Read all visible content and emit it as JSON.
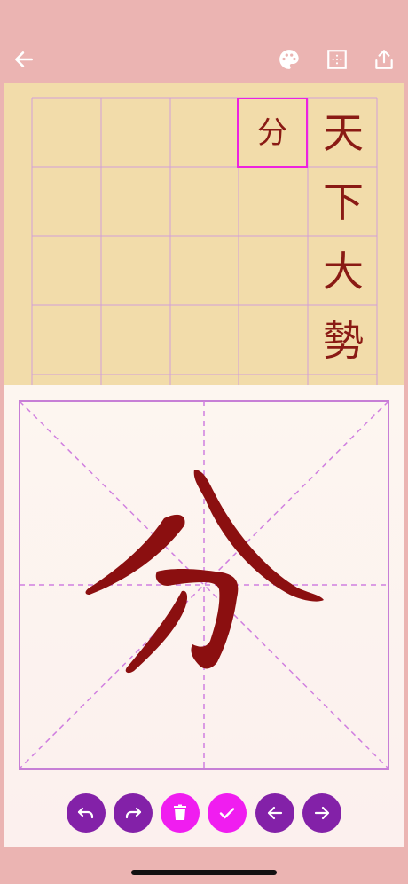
{
  "header": {
    "back_icon": "arrow-left-icon",
    "palette_icon": "palette-icon",
    "grid_icon": "grid-focus-icon",
    "share_icon": "share-icon"
  },
  "reference_column": {
    "characters": [
      "天",
      "下",
      "大",
      "勢"
    ]
  },
  "written_cells": [
    {
      "char": "分",
      "selected": true
    }
  ],
  "practice_pad": {
    "character": "分"
  },
  "toolbar": {
    "buttons": [
      {
        "icon": "undo-icon",
        "color": "#8321a8"
      },
      {
        "icon": "redo-icon",
        "color": "#8321a8"
      },
      {
        "icon": "trash-icon",
        "color": "#f01df0"
      },
      {
        "icon": "check-icon",
        "color": "#f01df0"
      },
      {
        "icon": "arrow-left-icon",
        "color": "#8321a8"
      },
      {
        "icon": "arrow-right-icon",
        "color": "#8321a8"
      }
    ]
  },
  "colors": {
    "background": "#ebb4b2",
    "paper": "#f2dcaa",
    "ink": "#8a1a14",
    "grid_line": "#d2a0d8",
    "selection": "#ee22e0",
    "accent_purple": "#8321a8",
    "accent_magenta": "#f01df0"
  }
}
